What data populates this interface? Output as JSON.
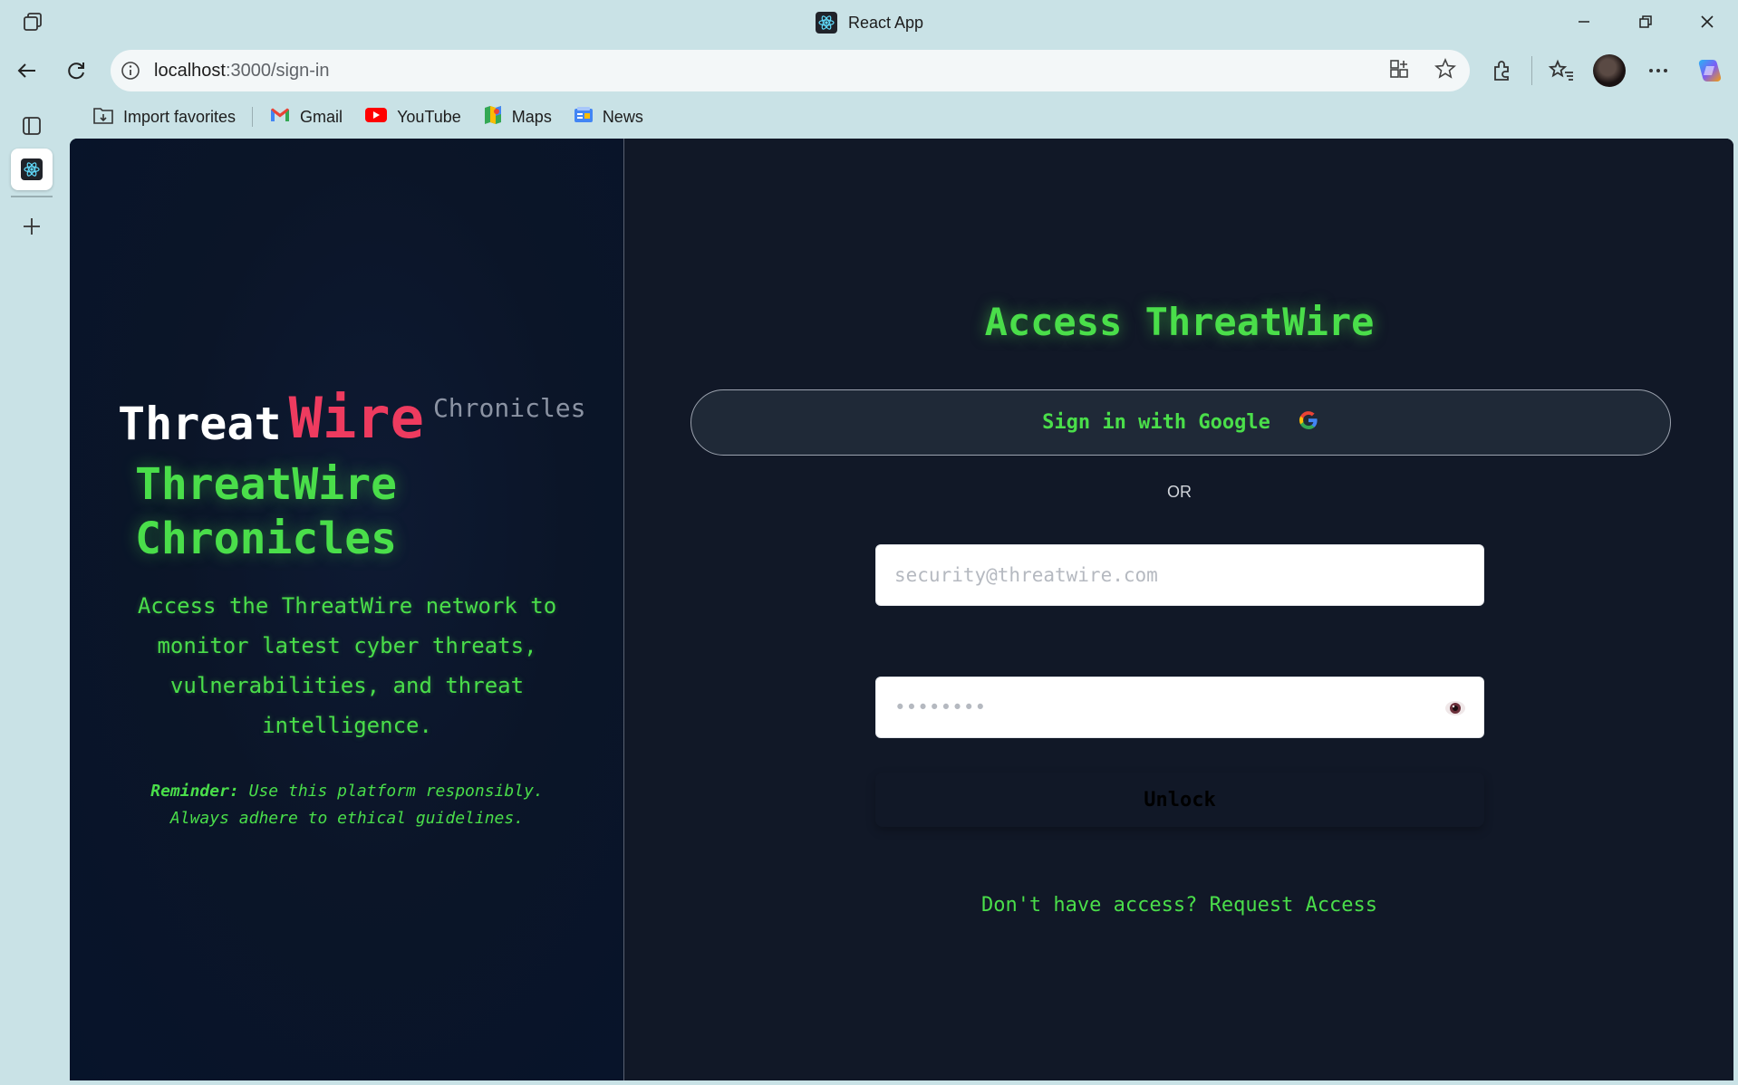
{
  "browser": {
    "window_title": "React App",
    "address": {
      "host": "localhost",
      "path": ":3000/sign-in"
    },
    "bookmarks": [
      {
        "label": "Import favorites",
        "icon": "import-icon"
      },
      {
        "label": "Gmail",
        "icon": "gmail-icon"
      },
      {
        "label": "YouTube",
        "icon": "youtube-icon"
      },
      {
        "label": "Maps",
        "icon": "maps-icon"
      },
      {
        "label": "News",
        "icon": "news-icon"
      }
    ]
  },
  "left": {
    "brand": {
      "threat": "Threat",
      "wire": "Wire",
      "chronicles": "Chronicles"
    },
    "hero_line1": "ThreatWire",
    "hero_line2": "Chronicles",
    "description": "Access the ThreatWire network to monitor latest cyber threats, vulnerabilities, and threat intelligence.",
    "reminder_label": "Reminder:",
    "reminder_text": " Use this platform responsibly. Always adhere to ethical guidelines."
  },
  "form": {
    "title": "Access ThreatWire",
    "google_label": "Sign in with Google",
    "or": "OR",
    "email_placeholder": "security@threatwire.com",
    "password_placeholder": "••••••••",
    "unlock_label": "Unlock",
    "request_text": "Don't have access? Request Access"
  },
  "colors": {
    "accent_green": "#4ade4a",
    "brand_red": "#ee3b5f",
    "panel_bg": "#111827",
    "left_bg": "#0b1528"
  }
}
